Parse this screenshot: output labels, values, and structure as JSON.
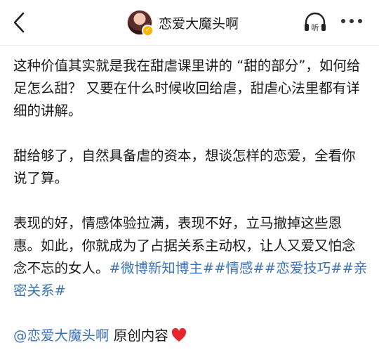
{
  "header": {
    "author_name": "恋爱大魔头啊",
    "listen_label": "听"
  },
  "post": {
    "p1": "这种价值其实就是我在甜虐课里讲的 “甜的部分”，如何给足怎么甜？ 又要在什么时候收回给虐，甜虐心法里都有详细的讲解。",
    "p2": "甜给够了，自然具备虐的资本，想谈怎样的恋爱，全看你说了算。",
    "p3_text": "表现的好，情感体验拉满，表现不好，立马撤掉这些恩惠。如此，你就成为了占据关系主动权，让人又爱又怕念念不忘的女人。",
    "tags": [
      "#微博新知博主#",
      "#情感#",
      "#恋爱技巧#",
      "#亲密关系#"
    ],
    "mention": "@恋爱大魔头啊",
    "original_label": "原创内容"
  },
  "colors": {
    "link": "#3d73b5",
    "heart": "#e8262b",
    "badge": "#f7b500"
  }
}
